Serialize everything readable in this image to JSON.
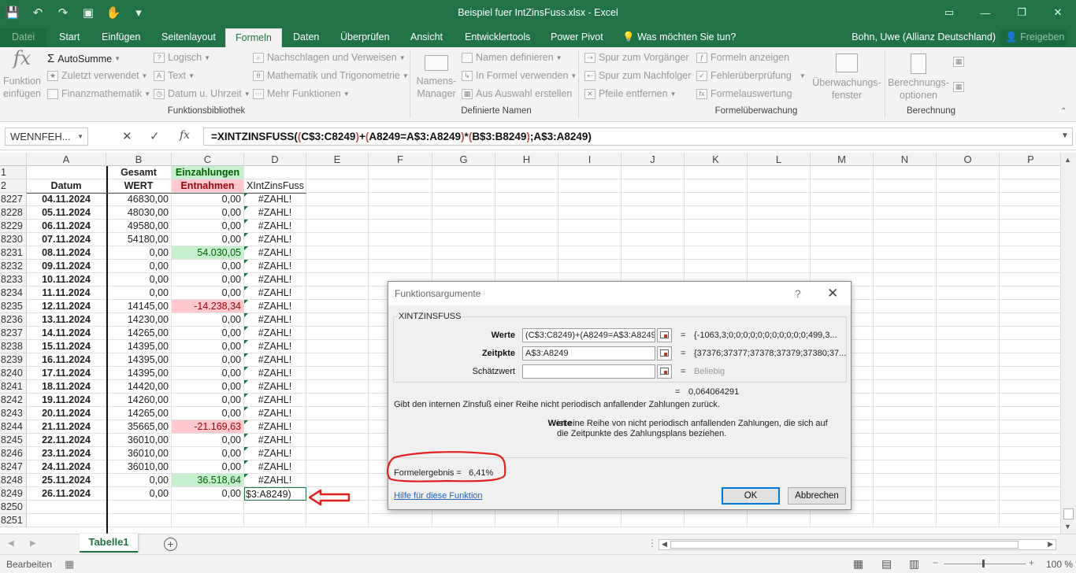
{
  "window": {
    "title": "Beispiel fuer IntZinsFuss.xlsx - Excel"
  },
  "qat": {
    "save": "💾",
    "undo": "↶",
    "redo": "↷",
    "touch": "✋",
    "more": "▾"
  },
  "tabs": {
    "datei": "Datei",
    "start": "Start",
    "einfuegen": "Einfügen",
    "seitenlayout": "Seitenlayout",
    "formeln": "Formeln",
    "daten": "Daten",
    "ueberpruefen": "Überprüfen",
    "ansicht": "Ansicht",
    "entwicklertools": "Entwicklertools",
    "powerpivot": "Power Pivot",
    "tell": "Was möchten Sie tun?"
  },
  "user": "Bohn, Uwe (Allianz Deutschland)",
  "share": "Freigeben",
  "ribbon": {
    "funktion_einfuegen": "Funktion\neinfügen",
    "autosumme": "AutoSumme",
    "zuletzt": "Zuletzt verwendet",
    "finanz": "Finanzmathematik",
    "logisch": "Logisch",
    "text": "Text",
    "datum": "Datum u. Uhrzeit",
    "nachschlagen": "Nachschlagen und Verweisen",
    "mathematik": "Mathematik und Trigonometrie",
    "mehr": "Mehr Funktionen",
    "grp_bibliothek": "Funktionsbibliothek",
    "namens_manager": "Namens-\nManager",
    "namen_definieren": "Namen definieren",
    "in_formel": "In Formel verwenden",
    "aus_auswahl": "Aus Auswahl erstellen",
    "grp_namen": "Definierte Namen",
    "spur_vorgaenger": "Spur zum Vorgänger",
    "spur_nachfolger": "Spur zum Nachfolger",
    "pfeile": "Pfeile entfernen",
    "formeln_anzeigen": "Formeln anzeigen",
    "fehler": "Fehlerüberprüfung",
    "auswertung": "Formelauswertung",
    "ueberwachung": "Überwachungs-\nfenster",
    "grp_ueberwachung": "Formelüberwachung",
    "berechnungsoptionen": "Berechnungs-\noptionen",
    "grp_berechnung": "Berechnung"
  },
  "formula_bar": {
    "namebox": "WENNFEH...",
    "p1": "=XINTZINSFUSS(",
    "p2": "(",
    "p3": "C$3:C8249",
    "p4": ")",
    "p5": "+",
    "p6": "(",
    "p7": "A8249=A$3:A8249",
    "p8": ")",
    "p9": "*",
    "p10": "(",
    "p11": "B$3:B8249",
    "p12": ")",
    "p13": ";A$3:A8249)"
  },
  "columns": [
    "A",
    "B",
    "C",
    "D",
    "E",
    "F",
    "G",
    "H",
    "I",
    "J",
    "K",
    "L",
    "M",
    "N",
    "O",
    "P"
  ],
  "header_rows": {
    "row1": {
      "num": "1",
      "B": "Gesamt",
      "C": "Einzahlungen"
    },
    "row2": {
      "num": "2",
      "A": "Datum",
      "B": "WERT",
      "C": "Entnahmen",
      "D": "XIntZinsFuss"
    }
  },
  "rows": [
    {
      "num": "8227",
      "A": "04.11.2024",
      "B": "46830,00",
      "C": "0,00",
      "D": "#ZAHL!"
    },
    {
      "num": "8228",
      "A": "05.11.2024",
      "B": "48030,00",
      "C": "0,00",
      "D": "#ZAHL!"
    },
    {
      "num": "8229",
      "A": "06.11.2024",
      "B": "49580,00",
      "C": "0,00",
      "D": "#ZAHL!"
    },
    {
      "num": "8230",
      "A": "07.11.2024",
      "B": "54180,00",
      "C": "0,00",
      "D": "#ZAHL!"
    },
    {
      "num": "8231",
      "A": "08.11.2024",
      "B": "0,00",
      "C": "54.030,05",
      "D": "#ZAHL!",
      "fill": "green"
    },
    {
      "num": "8232",
      "A": "09.11.2024",
      "B": "0,00",
      "C": "0,00",
      "D": "#ZAHL!"
    },
    {
      "num": "8233",
      "A": "10.11.2024",
      "B": "0,00",
      "C": "0,00",
      "D": "#ZAHL!"
    },
    {
      "num": "8234",
      "A": "11.11.2024",
      "B": "0,00",
      "C": "0,00",
      "D": "#ZAHL!"
    },
    {
      "num": "8235",
      "A": "12.11.2024",
      "B": "14145,00",
      "C": "-14.238,34",
      "D": "#ZAHL!",
      "fill": "red"
    },
    {
      "num": "8236",
      "A": "13.11.2024",
      "B": "14230,00",
      "C": "0,00",
      "D": "#ZAHL!"
    },
    {
      "num": "8237",
      "A": "14.11.2024",
      "B": "14265,00",
      "C": "0,00",
      "D": "#ZAHL!"
    },
    {
      "num": "8238",
      "A": "15.11.2024",
      "B": "14395,00",
      "C": "0,00",
      "D": "#ZAHL!"
    },
    {
      "num": "8239",
      "A": "16.11.2024",
      "B": "14395,00",
      "C": "0,00",
      "D": "#ZAHL!"
    },
    {
      "num": "8240",
      "A": "17.11.2024",
      "B": "14395,00",
      "C": "0,00",
      "D": "#ZAHL!"
    },
    {
      "num": "8241",
      "A": "18.11.2024",
      "B": "14420,00",
      "C": "0,00",
      "D": "#ZAHL!"
    },
    {
      "num": "8242",
      "A": "19.11.2024",
      "B": "14260,00",
      "C": "0,00",
      "D": "#ZAHL!"
    },
    {
      "num": "8243",
      "A": "20.11.2024",
      "B": "14265,00",
      "C": "0,00",
      "D": "#ZAHL!"
    },
    {
      "num": "8244",
      "A": "21.11.2024",
      "B": "35665,00",
      "C": "-21.169,63",
      "D": "#ZAHL!",
      "fill": "red"
    },
    {
      "num": "8245",
      "A": "22.11.2024",
      "B": "36010,00",
      "C": "0,00",
      "D": "#ZAHL!"
    },
    {
      "num": "8246",
      "A": "23.11.2024",
      "B": "36010,00",
      "C": "0,00",
      "D": "#ZAHL!"
    },
    {
      "num": "8247",
      "A": "24.11.2024",
      "B": "36010,00",
      "C": "0,00",
      "D": "#ZAHL!"
    },
    {
      "num": "8248",
      "A": "25.11.2024",
      "B": "0,00",
      "C": "36.518,64",
      "D": "#ZAHL!",
      "fill": "green"
    },
    {
      "num": "8249",
      "A": "26.11.2024",
      "B": "0,00",
      "C": "0,00",
      "D": "$3:A8249)",
      "editing": true
    },
    {
      "num": "8250",
      "A": "",
      "B": "",
      "C": "",
      "D": ""
    },
    {
      "num": "8251",
      "A": "",
      "B": "",
      "C": "",
      "D": ""
    }
  ],
  "sheet_tab": "Tabelle1",
  "status": {
    "mode": "Bearbeiten",
    "zoom": "100 %"
  },
  "dialog": {
    "title": "Funktionsargumente",
    "help_q": "?",
    "close": "✕",
    "function_name": "XINTZINSFUSS",
    "args": [
      {
        "label": "Werte",
        "value": "(C$3:C8249)+(A8249=A$3:A8249)*(B$3:B8249)",
        "result": "{-1063,3;0;0;0;0;0;0;0;0;0;0;0;499,3..."
      },
      {
        "label": "Zeitpkte",
        "value": "A$3:A8249",
        "result": "{37376;37377;37378;37379;37380;37..."
      },
      {
        "label": "Schätzwert",
        "value": "",
        "result": "Beliebig"
      }
    ],
    "eq": "=",
    "function_result": "0,064064291",
    "description": "Gibt den internen Zinsfuß einer Reihe nicht periodisch anfallender Zahlungen zurück.",
    "arg_name": "Werte",
    "arg_description": "ist eine Reihe von nicht periodisch anfallenden Zahlungen, die sich auf die Zeitpunkte des Zahlungsplans beziehen.",
    "formula_result_label": "Formelergebnis =",
    "formula_result_value": "6,41%",
    "help_link": "Hilfe für diese Funktion",
    "ok": "OK",
    "cancel": "Abbrechen"
  },
  "colors": {
    "excel_green": "#217346",
    "annotation_red": "#e0201b",
    "green_fill": "#c6efce",
    "red_fill": "#ffc7ce"
  }
}
